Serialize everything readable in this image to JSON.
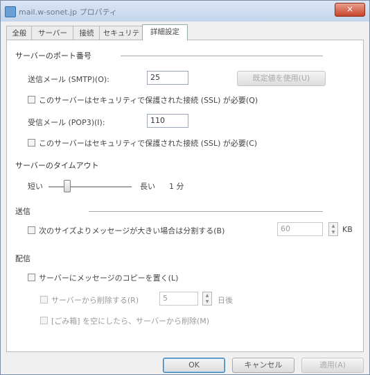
{
  "window": {
    "title": "mail.w-sonet.jp プロパティ",
    "close_label": "×"
  },
  "tabs": [
    {
      "label": "全般"
    },
    {
      "label": "サーバー"
    },
    {
      "label": "接続"
    },
    {
      "label": "セキュリティ"
    },
    {
      "label": "詳細設定"
    }
  ],
  "ports": {
    "section_title": "サーバーのポート番号",
    "smtp_label": "送信メール (SMTP)(O):",
    "smtp_value": "25",
    "default_button": "既定値を使用(U)",
    "ssl_smtp_label": "このサーバーはセキュリティで保護された接続 (SSL) が必要(Q)",
    "pop3_label": "受信メール (POP3)(I):",
    "pop3_value": "110",
    "ssl_pop3_label": "このサーバーはセキュリティで保護された接続 (SSL) が必要(C)"
  },
  "timeout": {
    "section_title": "サーバーのタイムアウト",
    "short_label": "短い",
    "long_label": "長い",
    "value_label": "1 分",
    "position_fraction": 0.2
  },
  "send": {
    "section_title": "送信",
    "split_label": "次のサイズよりメッセージが大きい場合は分割する(B)",
    "split_value": "60",
    "split_unit": "KB"
  },
  "delivery": {
    "section_title": "配信",
    "leave_copy_label": "サーバーにメッセージのコピーを置く(L)",
    "remove_after_label": "サーバーから削除する(R)",
    "remove_after_value": "5",
    "remove_after_unit": "日後",
    "remove_deleted_label": "[ごみ箱] を空にしたら、サーバーから削除(M)"
  },
  "buttons": {
    "ok": "OK",
    "cancel": "キャンセル",
    "apply": "適用(A)"
  }
}
